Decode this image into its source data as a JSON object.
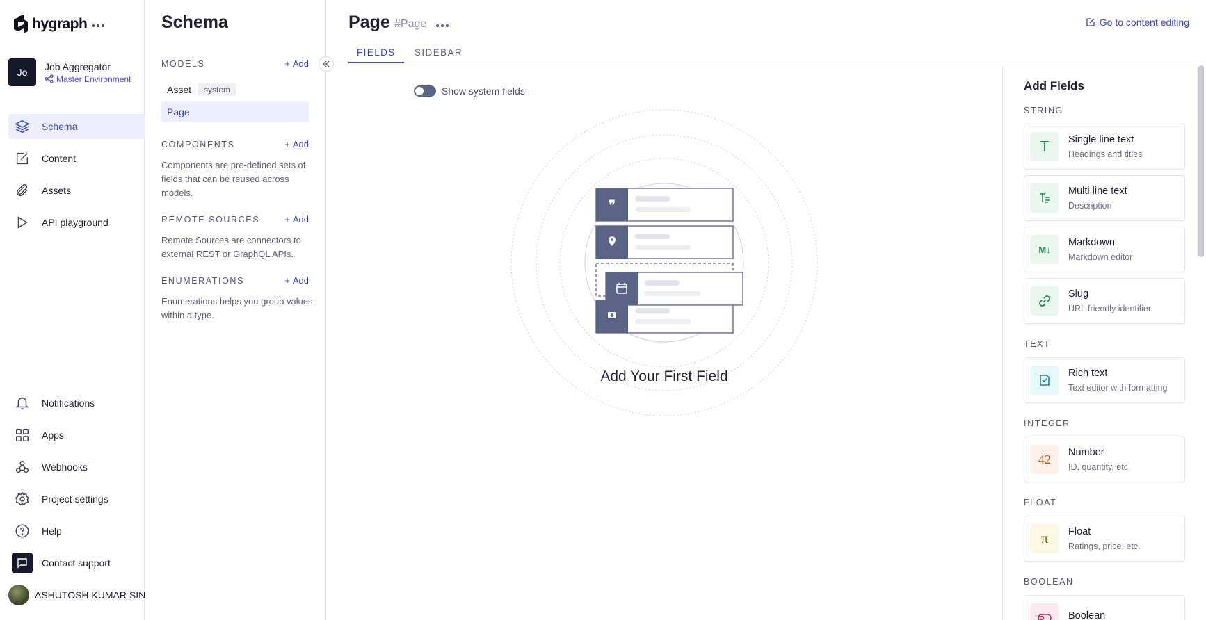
{
  "brand": {
    "name": "hygraph"
  },
  "project": {
    "avatar_initials": "Jo",
    "name": "Job Aggregator",
    "environment": "Master Environment"
  },
  "nav": {
    "items": [
      {
        "label": "Schema",
        "icon": "layers-icon"
      },
      {
        "label": "Content",
        "icon": "edit-icon"
      },
      {
        "label": "Assets",
        "icon": "paperclip-icon"
      },
      {
        "label": "API playground",
        "icon": "play-icon"
      }
    ],
    "bottom": [
      {
        "label": "Notifications",
        "icon": "bell-icon"
      },
      {
        "label": "Apps",
        "icon": "apps-icon"
      },
      {
        "label": "Webhooks",
        "icon": "webhook-icon"
      },
      {
        "label": "Project settings",
        "icon": "gear-icon"
      },
      {
        "label": "Help",
        "icon": "help-icon"
      },
      {
        "label": "Contact support",
        "icon": "chat-icon"
      }
    ],
    "user": "ASHUTOSH KUMAR SINGH"
  },
  "schema": {
    "title": "Schema",
    "models_title": "MODELS",
    "add_label": "Add",
    "models": [
      {
        "name": "Asset",
        "badge": "system"
      },
      {
        "name": "Page"
      }
    ],
    "components_title": "COMPONENTS",
    "components_desc": "Components are pre-defined sets of fields that can be reused across models.",
    "remote_title": "REMOTE SOURCES",
    "remote_desc": "Remote Sources are connectors to external REST or GraphQL APIs.",
    "enums_title": "ENUMERATIONS",
    "enums_desc": "Enumerations helps you group values within a type."
  },
  "header": {
    "title": "Page",
    "api_id": "#Page",
    "goto_label": "Go to content editing",
    "tabs": [
      {
        "label": "FIELDS"
      },
      {
        "label": "SIDEBAR"
      }
    ]
  },
  "main": {
    "toggle_label": "Show system fields",
    "empty_title": "Add Your First Field"
  },
  "panel": {
    "title": "Add Fields",
    "groups": [
      {
        "title": "STRING",
        "fields": [
          {
            "name": "Single line text",
            "desc": "Headings and titles",
            "icon": "T"
          },
          {
            "name": "Multi line text",
            "desc": "Description",
            "icon": "multiline-icon"
          },
          {
            "name": "Markdown",
            "desc": "Markdown editor",
            "icon": "markdown-icon"
          },
          {
            "name": "Slug",
            "desc": "URL friendly identifier",
            "icon": "link-icon"
          }
        ]
      },
      {
        "title": "TEXT",
        "fields": [
          {
            "name": "Rich text",
            "desc": "Text editor with formatting",
            "icon": "richtext-icon"
          }
        ]
      },
      {
        "title": "INTEGER",
        "fields": [
          {
            "name": "Number",
            "desc": "ID, quantity, etc.",
            "icon": "42"
          }
        ]
      },
      {
        "title": "FLOAT",
        "fields": [
          {
            "name": "Float",
            "desc": "Ratings, price, etc.",
            "icon": "π"
          }
        ]
      },
      {
        "title": "BOOLEAN",
        "fields": [
          {
            "name": "Boolean",
            "desc": "",
            "icon": "toggle-icon"
          }
        ]
      }
    ]
  },
  "colors": {
    "accent": "#3e47bd",
    "active_bg": "#eceefe",
    "dark": "#15192b",
    "illustration": "#5a6486"
  }
}
